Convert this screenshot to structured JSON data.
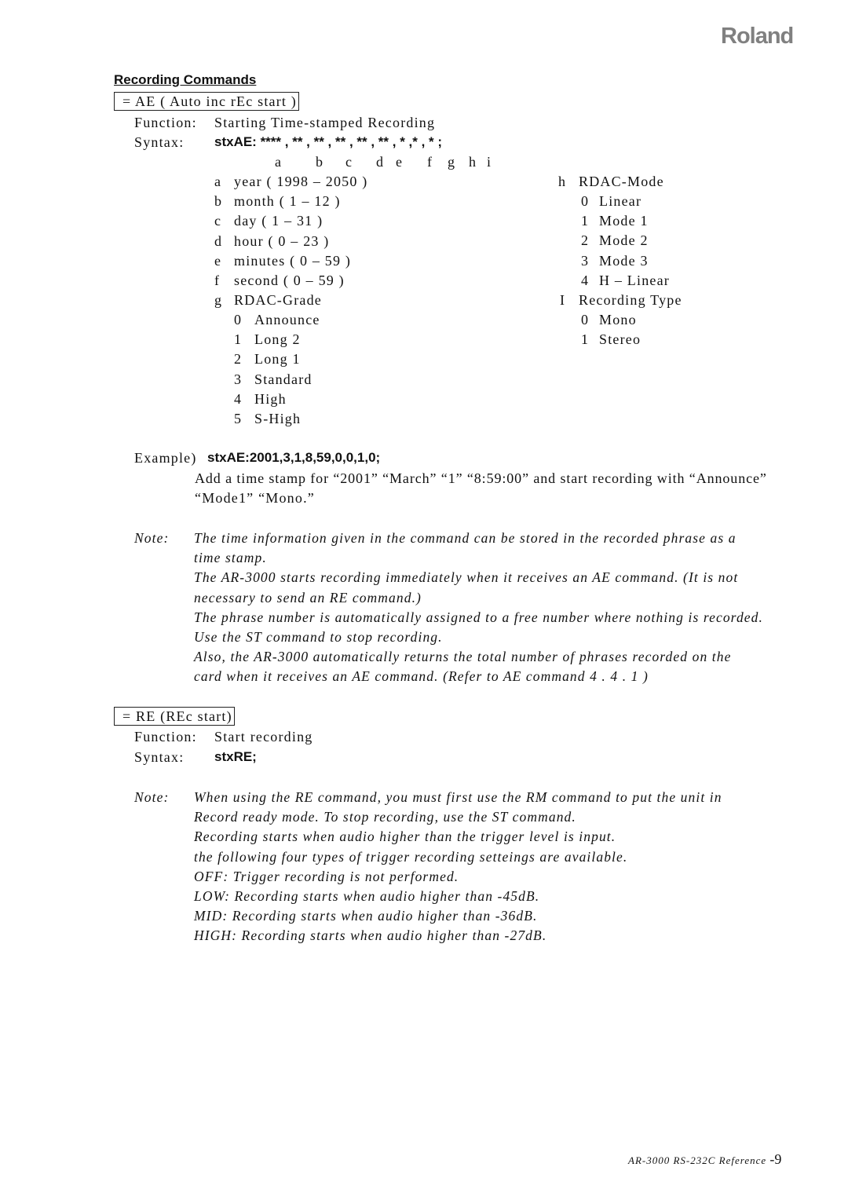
{
  "header": {
    "brand": "Roland"
  },
  "section_title": "Recording Commands",
  "ae": {
    "box_label": "= AE ( Auto inc rEc start )",
    "function_label": "Function:",
    "function_value": "Starting Time-stamped Recording",
    "syntax_label": "Syntax:",
    "syntax_value": "stxAE: **** , ** , ** , ** , ** , ** , * ,* , * ;",
    "param_letters": [
      "a",
      "b",
      "c",
      "d",
      "e",
      "f",
      "g",
      "h",
      "i"
    ],
    "params_left": [
      {
        "key": "a",
        "text": "year ( 1998 – 2050 )"
      },
      {
        "key": "b",
        "text": "month ( 1 – 12 )"
      },
      {
        "key": "c",
        "text": "day ( 1 – 31 )"
      },
      {
        "key": "d",
        "text": "hour ( 0 – 23 )"
      },
      {
        "key": "e",
        "text": "minutes ( 0 – 59 )"
      },
      {
        "key": "f",
        "text": "second ( 0 – 59 )"
      },
      {
        "key": "g",
        "text": "RDAC-Grade"
      }
    ],
    "grade_options": [
      {
        "key": "0",
        "text": "Announce"
      },
      {
        "key": "1",
        "text": "Long 2"
      },
      {
        "key": "2",
        "text": "Long 1"
      },
      {
        "key": "3",
        "text": "Standard"
      },
      {
        "key": "4",
        "text": "High"
      },
      {
        "key": "5",
        "text": "S-High"
      }
    ],
    "mode_param": {
      "key": "h",
      "text": "RDAC-Mode"
    },
    "mode_options": [
      {
        "key": "0",
        "text": "Linear"
      },
      {
        "key": "1",
        "text": "Mode 1"
      },
      {
        "key": "2",
        "text": "Mode 2"
      },
      {
        "key": "3",
        "text": "Mode 3"
      },
      {
        "key": "4",
        "text": "H – Linear"
      }
    ],
    "type_param": {
      "key": "I",
      "text": "Recording Type"
    },
    "type_options": [
      {
        "key": "0",
        "text": "Mono"
      },
      {
        "key": "1",
        "text": "Stereo"
      }
    ],
    "example_label": "Example)",
    "example_value": "stxAE:2001,3,1,8,59,0,0,1,0;",
    "example_desc_1": "Add a time stamp for “2001” “March” “1” “8:59:00” and start recording with “Announce”",
    "example_desc_2": "“Mode1” “Mono.”",
    "note_label": "Note:",
    "notes": [
      "The time information given in the command can be stored in the recorded phrase as a",
      "time stamp.",
      "The AR-3000 starts recording immediately when it receives an AE command. (It is not",
      "necessary to send an RE command.)",
      "The phrase number is automatically assigned to a free number where nothing is recorded.",
      "Use the ST command to stop recording.",
      "Also, the AR-3000 automatically returns the total number of phrases recorded on the",
      "card when it receives an AE command. (Refer to AE command    4 . 4 . 1 )"
    ]
  },
  "re": {
    "box_label": "= RE (REc start)",
    "function_label": "Function:",
    "function_value": "Start recording",
    "syntax_label": "Syntax:",
    "syntax_value": "stxRE;",
    "note_label": "Note:",
    "notes": [
      "When using the RE command, you must first use the RM command to put the unit in",
      "Record ready mode. To stop recording, use the ST command.",
      "Recording starts when audio higher than the trigger level is input.",
      "the following four types of trigger recording setteings are available.",
      "OFF: Trigger recording is not performed.",
      "LOW: Recording starts when audio higher than -45dB.",
      "MID: Recording starts when audio higher than -36dB.",
      "HIGH: Recording starts when audio higher than -27dB."
    ]
  },
  "footer": {
    "reference": "AR-3000 RS-232C Reference",
    "page": "-9"
  }
}
